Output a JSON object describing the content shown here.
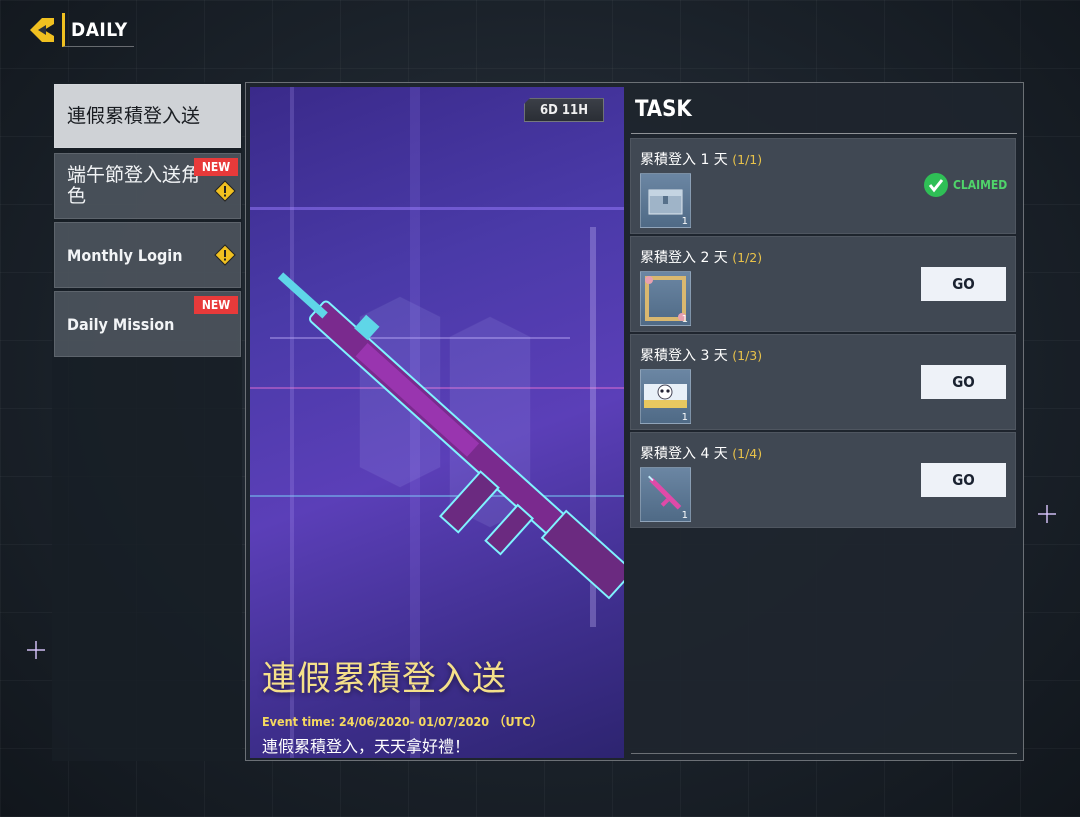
{
  "header": {
    "title": "DAILY",
    "back_icon": "back-arrow-icon",
    "accent": "#f0c020"
  },
  "sidebar": {
    "items": [
      {
        "label": "連假累積登入送",
        "active": true
      },
      {
        "label": "端午節登入送角色",
        "badge": "NEW",
        "warning": true
      },
      {
        "label": "Monthly Login",
        "warning": true
      },
      {
        "label": "Daily Mission",
        "badge": "NEW"
      }
    ]
  },
  "banner": {
    "countdown": "6D 11H",
    "title": "連假累積登入送",
    "event_time": "Event time:  24/06/2020- 01/07/2020 （UTC）",
    "description": "連假累積登入，天天拿好禮！"
  },
  "tasks": {
    "heading": "TASK",
    "items": [
      {
        "name": "累積登入 1 天",
        "progress": "(1/1)",
        "reward_icon": "crate-icon",
        "qty": "1",
        "status": "CLAIMED"
      },
      {
        "name": "累積登入 2 天",
        "progress": "(1/2)",
        "reward_icon": "frame-icon",
        "qty": "1",
        "button": "GO"
      },
      {
        "name": "累積登入 3 天",
        "progress": "(1/3)",
        "reward_icon": "skull-emblem-icon",
        "qty": "1",
        "button": "GO"
      },
      {
        "name": "累積登入 4 天",
        "progress": "(1/4)",
        "reward_icon": "rifle-icon",
        "qty": "1",
        "button": "GO"
      }
    ]
  },
  "colors": {
    "progress": "#e8c24a",
    "claimed": "#4fd46a",
    "new_badge": "#e83a3a"
  }
}
